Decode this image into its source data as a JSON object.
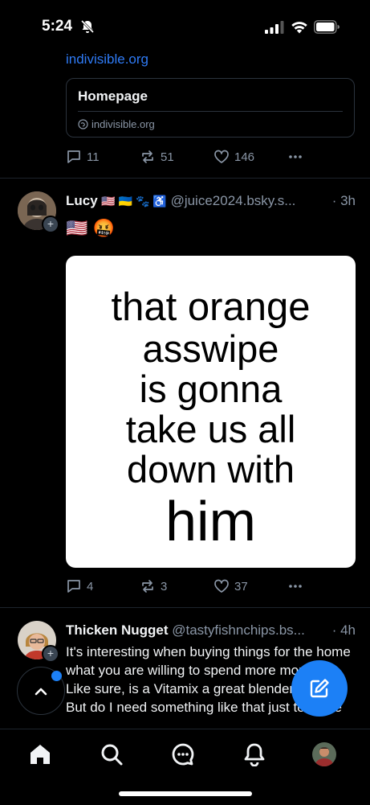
{
  "status_bar": {
    "time": "5:24"
  },
  "post1": {
    "link_text": "indivisible.org",
    "card": {
      "title": "Homepage",
      "domain": "indivisible.org"
    },
    "counts": {
      "replies": "11",
      "reposts": "51",
      "likes": "146"
    }
  },
  "post2": {
    "author_name": "Lucy",
    "author_emoji": "🇺🇸 🇺🇦 🐾 ♿",
    "handle": "@juice2024.bsky.s...",
    "time": "· 3h",
    "text": "🇺🇸 🤬",
    "image_text": {
      "line1": "that orange",
      "line2": "asswipe",
      "line3": "is gonna",
      "line4": "take us all",
      "line5": "down with",
      "line6": "him"
    },
    "counts": {
      "replies": "4",
      "reposts": "3",
      "likes": "37"
    }
  },
  "post3": {
    "author_name": "Thicken Nugget",
    "handle": "@tastyfishnchips.bs...",
    "time": "· 4h",
    "text": "It's interesting when buying things for the home what you are willing to spend more money on. Like sure, is a Vitamix a great blender? Yes. But do I need something like that just to make"
  },
  "colors": {
    "accent": "#1c80f6",
    "link": "#2f7bf6",
    "muted": "#8a96a6",
    "background": "#000000"
  },
  "tabbar": {
    "items": [
      "home-icon",
      "search-icon",
      "chat-icon",
      "notifications-icon",
      "profile-avatar"
    ]
  }
}
